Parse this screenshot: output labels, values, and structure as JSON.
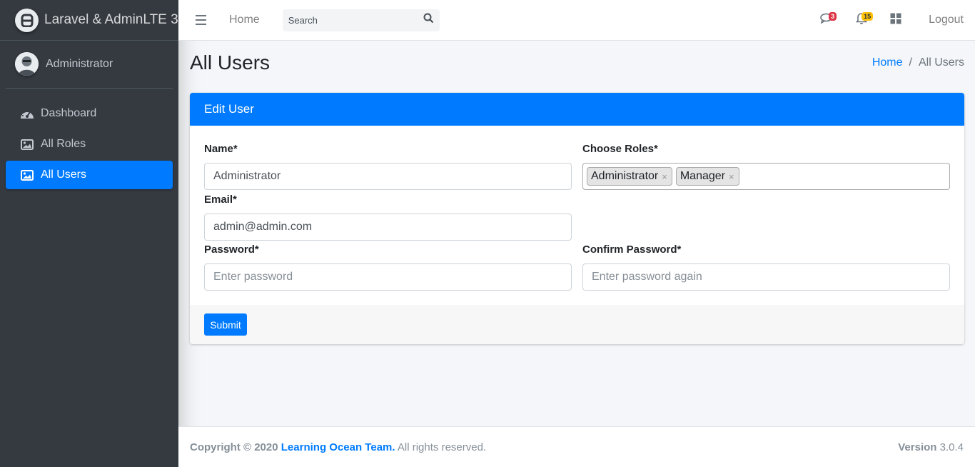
{
  "brand": {
    "name": "Laravel & AdminLTE 3",
    "logo_icon": "adminlte-logo-icon"
  },
  "user": {
    "name": "Administrator"
  },
  "sidebar": {
    "items": [
      {
        "label": "Dashboard",
        "icon": "tachometer-icon"
      },
      {
        "label": "All Roles",
        "icon": "image-icon"
      },
      {
        "label": "All Users",
        "icon": "image-icon",
        "active": true
      }
    ]
  },
  "topbar": {
    "home_label": "Home",
    "search_placeholder": "Search",
    "messages_count": "3",
    "notifications_count": "15",
    "logout_label": "Logout"
  },
  "page": {
    "title": "All Users",
    "breadcrumb": {
      "home": "Home",
      "separator": "/",
      "current": "All Users"
    }
  },
  "form": {
    "card_title": "Edit User",
    "name_label": "Name*",
    "name_value": "Administrator",
    "roles_label": "Choose Roles*",
    "roles": [
      "Administrator",
      "Manager"
    ],
    "email_label": "Email*",
    "email_value": "admin@admin.com",
    "password_label": "Password*",
    "password_placeholder": "Enter password",
    "confirm_label": "Confirm Password*",
    "confirm_placeholder": "Enter password again",
    "submit_label": "Submit",
    "tag_remove": "×"
  },
  "footer": {
    "copyright": "Copyright © 2020",
    "team": "Learning Ocean Team.",
    "rights": "All rights reserved.",
    "version_label": "Version",
    "version": "3.0.4"
  },
  "colors": {
    "primary": "#007bff",
    "sidebar": "#343a40",
    "danger": "#dc3545",
    "warning": "#ffc107"
  }
}
